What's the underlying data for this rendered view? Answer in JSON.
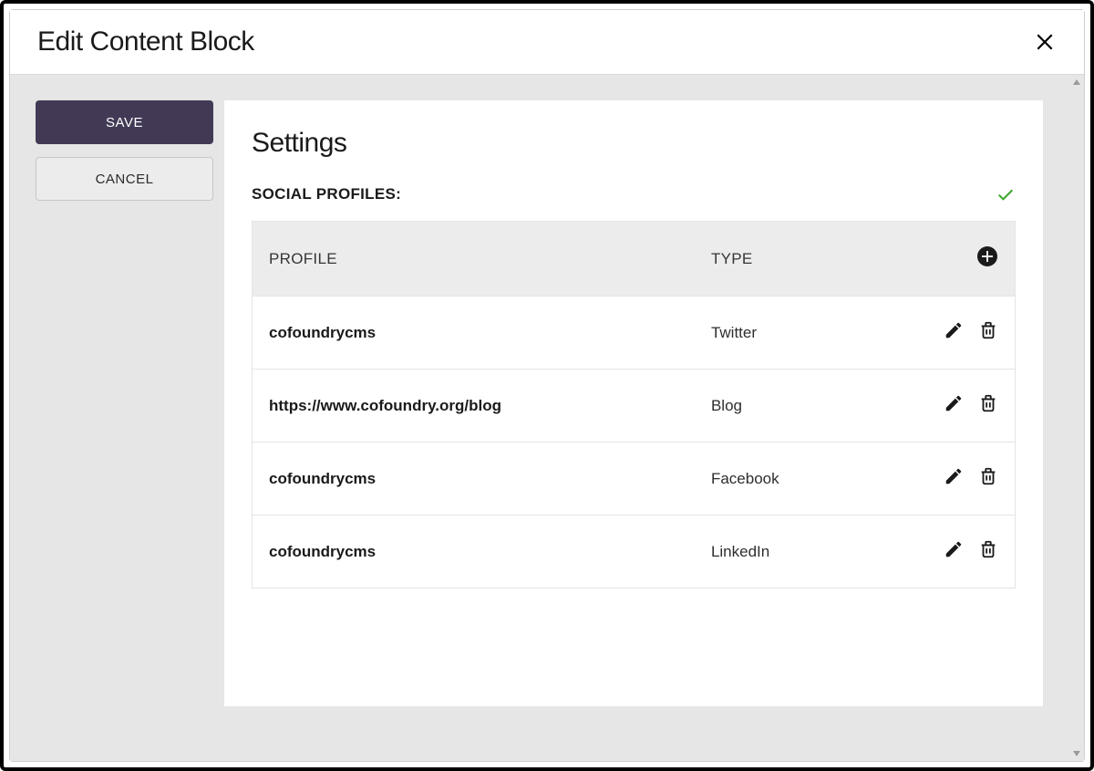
{
  "modal": {
    "title": "Edit Content Block"
  },
  "actions": {
    "save": "SAVE",
    "cancel": "CANCEL"
  },
  "panel": {
    "title": "Settings",
    "section_label": "SOCIAL PROFILES:",
    "table": {
      "headers": {
        "profile": "PROFILE",
        "type": "TYPE"
      },
      "rows": [
        {
          "profile": "cofoundrycms",
          "type": "Twitter"
        },
        {
          "profile": "https://www.cofoundry.org/blog",
          "type": "Blog"
        },
        {
          "profile": "cofoundrycms",
          "type": "Facebook"
        },
        {
          "profile": "cofoundrycms",
          "type": "LinkedIn"
        }
      ]
    }
  }
}
